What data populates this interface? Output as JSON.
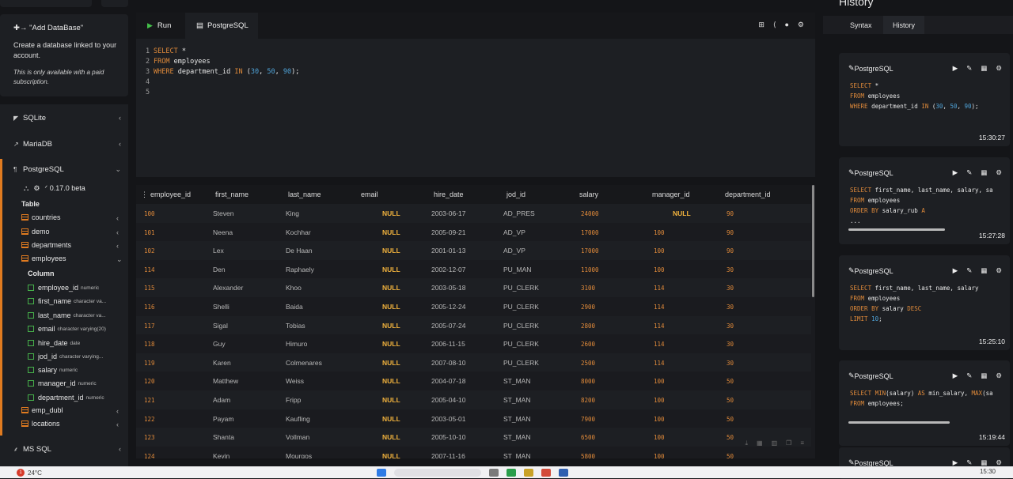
{
  "sidebar": {
    "add_db": {
      "title": "\"Add DataBase\"",
      "desc": "Create a database linked to your account.",
      "note": "This is only available with a paid subscription."
    },
    "databases": [
      {
        "label": "SQLite"
      },
      {
        "label": "MariaDB"
      },
      {
        "label": "PostgreSQL"
      },
      {
        "label": "MS SQL"
      }
    ],
    "version": "0.17.0 beta",
    "table_heading": "Table",
    "column_heading": "Column",
    "tables": [
      "countries",
      "demo",
      "departments",
      "employees",
      "emp_dubl",
      "locations"
    ],
    "columns": [
      {
        "name": "employee_id",
        "type": "numeric"
      },
      {
        "name": "first_name",
        "type": "character va..."
      },
      {
        "name": "last_name",
        "type": "character va..."
      },
      {
        "name": "email",
        "type": "character varying(20)"
      },
      {
        "name": "hire_date",
        "type": "date"
      },
      {
        "name": "jod_id",
        "type": "character varying..."
      },
      {
        "name": "salary",
        "type": "numeric"
      },
      {
        "name": "manager_id",
        "type": "numeric"
      },
      {
        "name": "department_id",
        "type": "numeric"
      }
    ]
  },
  "editor": {
    "run_label": "Run",
    "engine_label": "PostgreSQL",
    "line_numbers": [
      "1",
      "2",
      "3",
      "4",
      "5"
    ],
    "kw_select": "SELECT",
    "star": " *",
    "kw_from": "FROM",
    "table": " employees",
    "kw_where": "WHERE",
    "where_col": " department_id ",
    "kw_in": "IN",
    "open": " (",
    "n1": "30",
    "comma1": ", ",
    "n2": "50",
    "comma2": ", ",
    "n3": "90",
    "close": ");"
  },
  "grid": {
    "headers": [
      "employee_id",
      "first_name",
      "last_name",
      "email",
      "hire_date",
      "jod_id",
      "salary",
      "manager_id",
      "department_id"
    ],
    "rows": [
      [
        "100",
        "Steven",
        "King",
        "NULL",
        "2003-06-17",
        "AD_PRES",
        "24000",
        "NULL",
        "90"
      ],
      [
        "101",
        "Neena",
        "Kochhar",
        "NULL",
        "2005-09-21",
        "AD_VP",
        "17000",
        "100",
        "90"
      ],
      [
        "102",
        "Lex",
        "De Haan",
        "NULL",
        "2001-01-13",
        "AD_VP",
        "17000",
        "100",
        "90"
      ],
      [
        "114",
        "Den",
        "Raphaely",
        "NULL",
        "2002-12-07",
        "PU_MAN",
        "11000",
        "100",
        "30"
      ],
      [
        "115",
        "Alexander",
        "Khoo",
        "NULL",
        "2003-05-18",
        "PU_CLERK",
        "3100",
        "114",
        "30"
      ],
      [
        "116",
        "Shelli",
        "Baida",
        "NULL",
        "2005-12-24",
        "PU_CLERK",
        "2900",
        "114",
        "30"
      ],
      [
        "117",
        "Sigal",
        "Tobias",
        "NULL",
        "2005-07-24",
        "PU_CLERK",
        "2800",
        "114",
        "30"
      ],
      [
        "118",
        "Guy",
        "Himuro",
        "NULL",
        "2006-11-15",
        "PU_CLERK",
        "2600",
        "114",
        "30"
      ],
      [
        "119",
        "Karen",
        "Colmenares",
        "NULL",
        "2007-08-10",
        "PU_CLERK",
        "2500",
        "114",
        "30"
      ],
      [
        "120",
        "Matthew",
        "Weiss",
        "NULL",
        "2004-07-18",
        "ST_MAN",
        "8000",
        "100",
        "50"
      ],
      [
        "121",
        "Adam",
        "Fripp",
        "NULL",
        "2005-04-10",
        "ST_MAN",
        "8200",
        "100",
        "50"
      ],
      [
        "122",
        "Payam",
        "Kaufling",
        "NULL",
        "2003-05-01",
        "ST_MAN",
        "7900",
        "100",
        "50"
      ],
      [
        "123",
        "Shanta",
        "Vollman",
        "NULL",
        "2005-10-10",
        "ST_MAN",
        "6500",
        "100",
        "50"
      ],
      [
        "124",
        "Kevin",
        "Mourgos",
        "NULL",
        "2007-11-16",
        "ST_MAN",
        "5800",
        "100",
        "50"
      ]
    ]
  },
  "history": {
    "title": "History",
    "tab_syntax": "Syntax",
    "tab_history": "History",
    "cards": [
      {
        "engine": "PostgreSQL",
        "time": "15:30:27",
        "lines": [
          [
            [
              "kw",
              "SELECT"
            ],
            [
              "txt",
              " *"
            ]
          ],
          [
            [
              "kw",
              "FROM"
            ],
            [
              "txt",
              " employees"
            ]
          ],
          [
            [
              "kw",
              "WHERE"
            ],
            [
              "txt",
              " department_id "
            ],
            [
              "kw",
              "IN"
            ],
            [
              "txt",
              " ("
            ],
            [
              "num",
              "30"
            ],
            [
              "txt",
              ", "
            ],
            [
              "num",
              "50"
            ],
            [
              "txt",
              ", "
            ],
            [
              "num",
              "90"
            ],
            [
              "txt",
              ");"
            ]
          ]
        ]
      },
      {
        "engine": "PostgreSQL",
        "time": "15:27:28",
        "lines": [
          [
            [
              "kw",
              "SELECT"
            ],
            [
              "txt",
              " first_name, last_name, salary, sa"
            ]
          ],
          [
            [
              "kw",
              "FROM"
            ],
            [
              "txt",
              " employees"
            ]
          ],
          [
            [
              "kw",
              "ORDER BY"
            ],
            [
              "txt",
              " salary_rub "
            ],
            [
              "kw",
              "A"
            ]
          ],
          [
            [
              "txt",
              "..."
            ]
          ]
        ]
      },
      {
        "engine": "PostgreSQL",
        "time": "15:25:10",
        "lines": [
          [
            [
              "kw",
              "SELECT"
            ],
            [
              "txt",
              " first_name, last_name, salary"
            ]
          ],
          [
            [
              "kw",
              "FROM"
            ],
            [
              "txt",
              " employees"
            ]
          ],
          [
            [
              "kw",
              "ORDER BY"
            ],
            [
              "txt",
              " salary "
            ],
            [
              "kw",
              "DESC"
            ]
          ],
          [
            [
              "kw",
              "LIMIT"
            ],
            [
              "txt",
              " "
            ],
            [
              "num",
              "10"
            ],
            [
              "txt",
              ";"
            ]
          ]
        ]
      },
      {
        "engine": "PostgreSQL",
        "time": "15:19:44",
        "lines": [
          [
            [
              "kw",
              "SELECT MIN"
            ],
            [
              "txt",
              "(salary) "
            ],
            [
              "kw",
              "AS"
            ],
            [
              "txt",
              " min_salary, "
            ],
            [
              "kw",
              "MAX"
            ],
            [
              "txt",
              "(sa"
            ]
          ],
          [
            [
              "kw",
              "FROM"
            ],
            [
              "txt",
              " employees;"
            ]
          ]
        ]
      },
      {
        "engine": "PostgreSQL",
        "time": "",
        "lines": []
      }
    ]
  },
  "taskbar": {
    "temperature": "24°C",
    "clock": "15:30"
  }
}
